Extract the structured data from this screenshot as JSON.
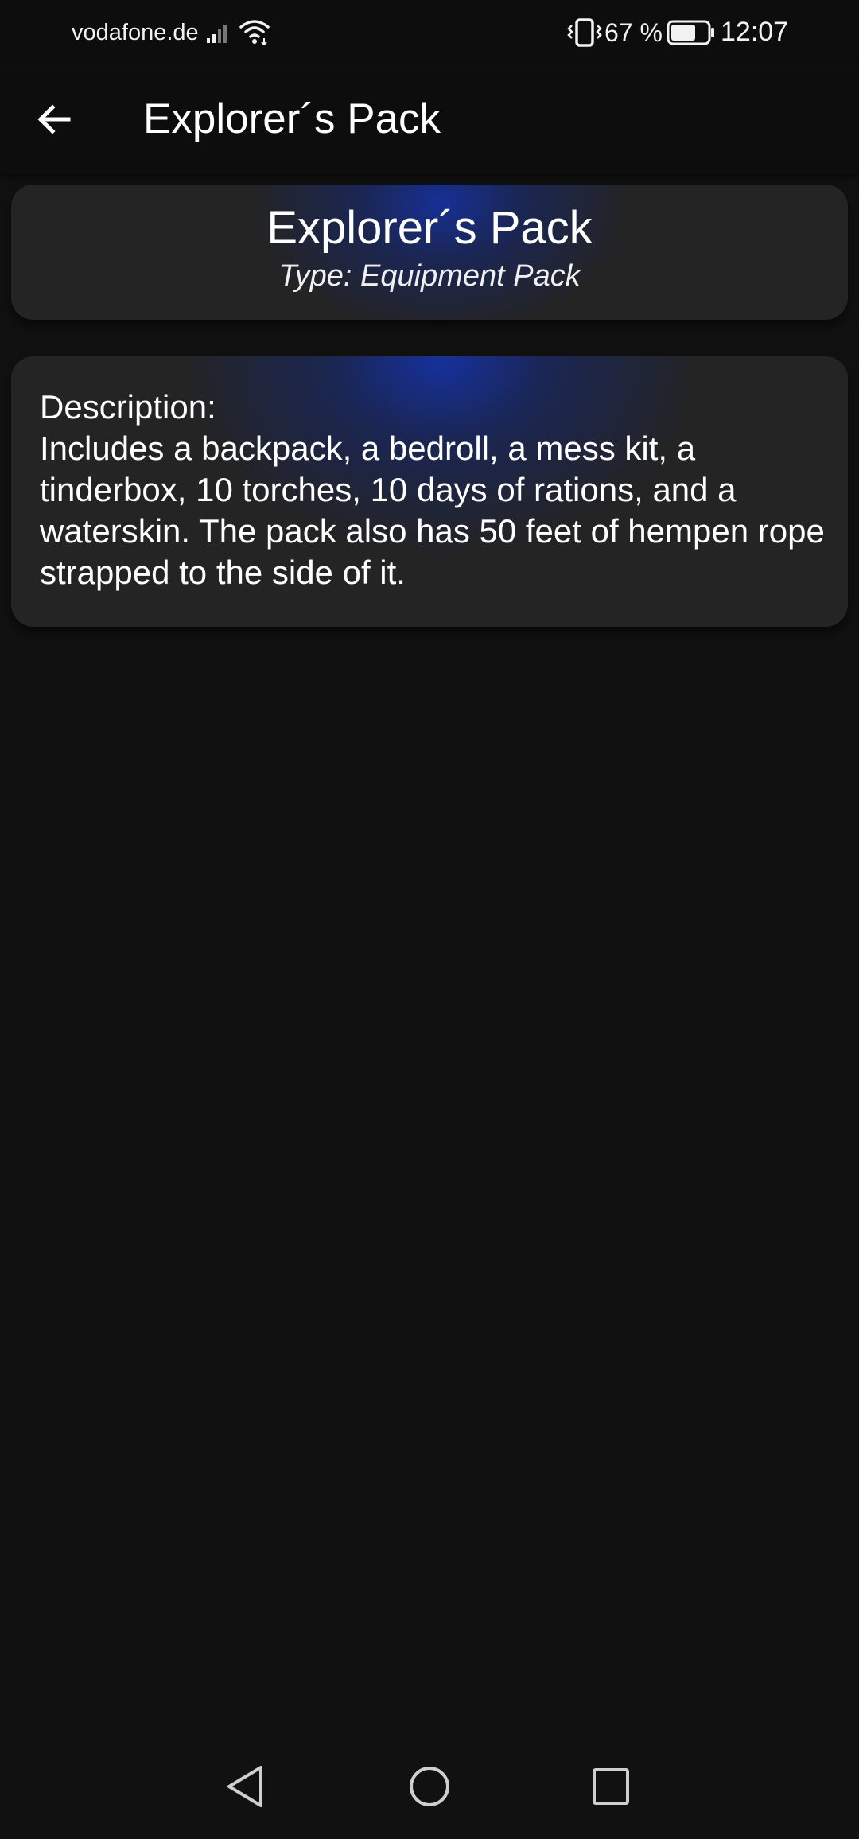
{
  "status_bar": {
    "carrier": "vodafone.de",
    "battery_percent": "67 %",
    "time": "12:07",
    "icons": [
      "signal-icon",
      "wifi-icon",
      "vibrate-icon",
      "battery-icon"
    ]
  },
  "app_bar": {
    "title": "Explorer´s Pack",
    "back_icon": "arrow-left-icon"
  },
  "item": {
    "name": "Explorer´s Pack",
    "type": "Type: Equipment Pack",
    "description_label": "Description:",
    "description": "Includes a backpack, a bedroll, a mess kit, a tinderbox, 10 torches, 10 days of rations, and a waterskin. The pack also has 50 feet of hempen rope strapped to the side of it."
  },
  "nav_bar": {
    "icons": [
      "nav-back-icon",
      "nav-home-icon",
      "nav-recents-icon"
    ]
  },
  "colors": {
    "background": "#111111",
    "card": "#242424",
    "glow": "#14329a",
    "text": "#ffffff"
  }
}
